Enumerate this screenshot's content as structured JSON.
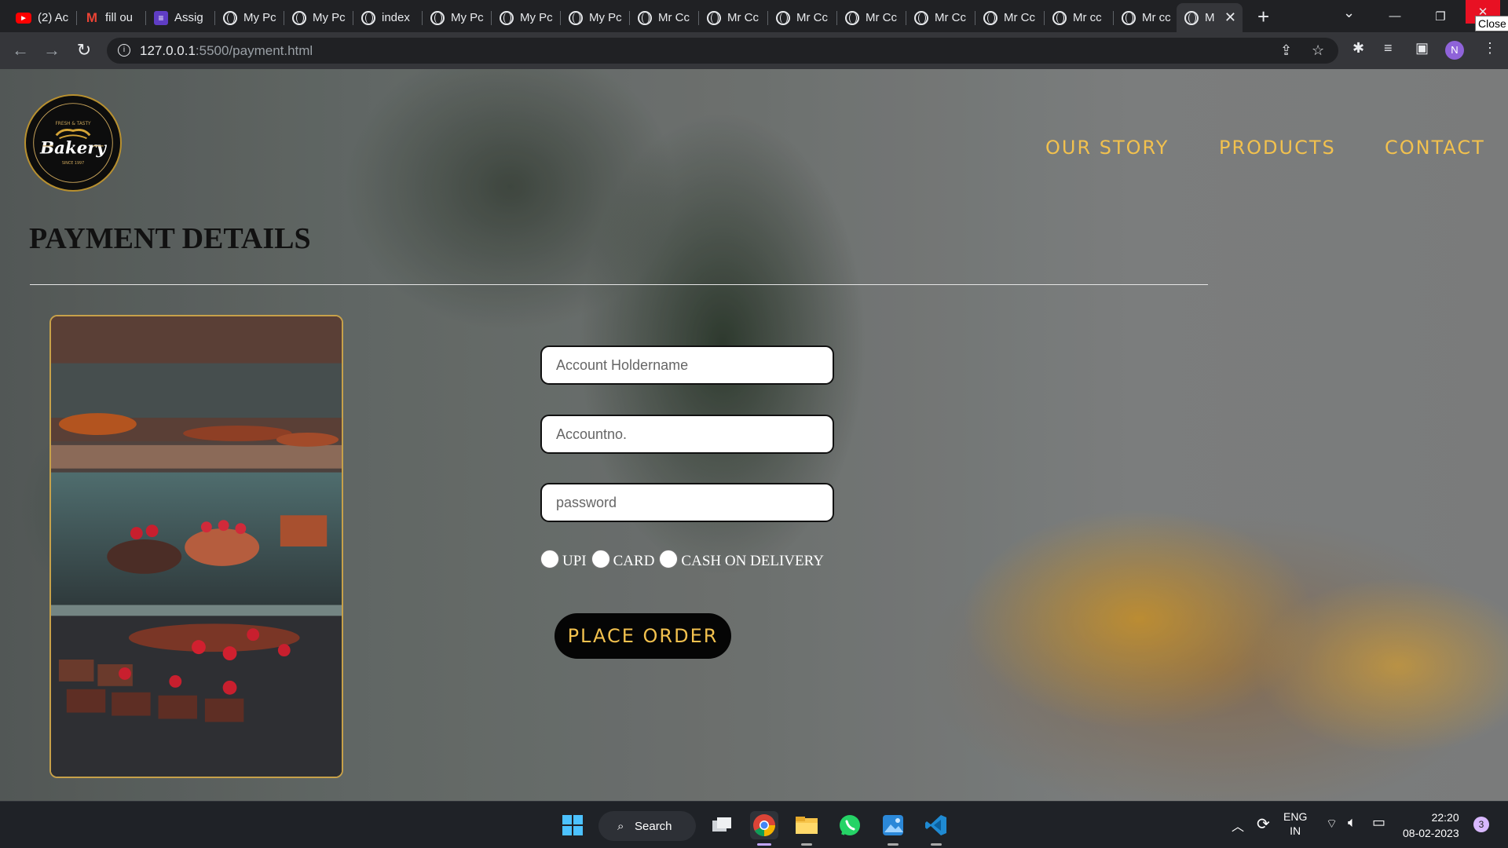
{
  "browser": {
    "tabs": [
      {
        "icon": "youtube-icon",
        "title": "(2) Ac"
      },
      {
        "icon": "gmail-icon",
        "title": "fill ou"
      },
      {
        "icon": "classroom-icon",
        "title": "Assig"
      },
      {
        "icon": "globe-icon",
        "title": "My Pc"
      },
      {
        "icon": "globe-icon",
        "title": "My Pc"
      },
      {
        "icon": "globe-icon",
        "title": "index"
      },
      {
        "icon": "globe-icon",
        "title": "My Pc"
      },
      {
        "icon": "globe-icon",
        "title": "My Pc"
      },
      {
        "icon": "globe-icon",
        "title": "My Pc"
      },
      {
        "icon": "globe-icon",
        "title": "Mr Cc"
      },
      {
        "icon": "globe-icon",
        "title": "Mr Cc"
      },
      {
        "icon": "globe-icon",
        "title": "Mr Cc"
      },
      {
        "icon": "globe-icon",
        "title": "Mr Cc"
      },
      {
        "icon": "globe-icon",
        "title": "Mr Cc"
      },
      {
        "icon": "globe-icon",
        "title": "Mr Cc"
      },
      {
        "icon": "globe-icon",
        "title": "Mr cc"
      },
      {
        "icon": "globe-icon",
        "title": "Mr cc"
      },
      {
        "icon": "globe-icon",
        "title": "M"
      }
    ],
    "active_tab_index": 17,
    "close_tooltip": "Close",
    "url_host": "127.0.0.1",
    "url_path": ":5500/payment.html",
    "profile_initial": "N"
  },
  "site": {
    "logo_text": "Bakery",
    "logo_tagline": "FRESH & TASTY",
    "logo_since": "SINCE 1997",
    "nav": [
      {
        "label": "OUR STORY"
      },
      {
        "label": "PRODUCTS"
      },
      {
        "label": "CONTACT"
      }
    ],
    "title": "PAYMENT DETAILS",
    "form": {
      "holder_placeholder": "Account Holdername",
      "account_placeholder": "Accountno.",
      "password_placeholder": "password",
      "payment_options": [
        {
          "label": "UPI"
        },
        {
          "label": "CARD"
        },
        {
          "label": "CASH ON DELIVERY"
        }
      ],
      "submit_label": "PLACE ORDER"
    },
    "colors": {
      "nav_gold": "#f2c14e",
      "button_bg": "#050505",
      "photo_border": "#c7a14a"
    }
  },
  "taskbar": {
    "search_label": "Search",
    "language": "ENG",
    "region": "IN",
    "time": "22:20",
    "date": "08-02-2023",
    "notification_count": "3"
  }
}
